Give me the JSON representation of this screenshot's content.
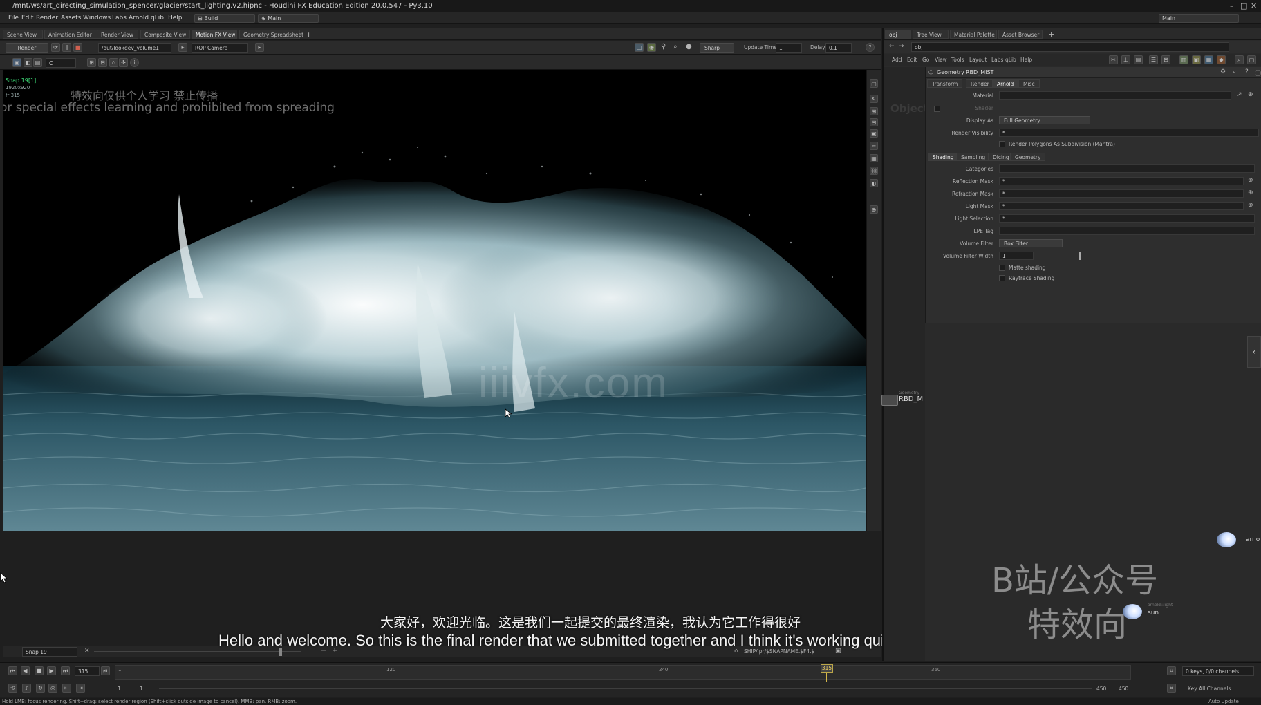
{
  "window": {
    "title": "/mnt/ws/art_directing_simulation_spencer/glacier/start_lighting.v2.hipnc - Houdini FX Education Edition 20.0.547 - Py3.10"
  },
  "menubar": {
    "items": [
      "File",
      "Edit",
      "Render",
      "Assets",
      "Windows",
      "Labs",
      "Arnold",
      "qLib",
      "Help"
    ],
    "desktop": "Build",
    "desktop2": "Main",
    "right_desktop": "Main"
  },
  "left_tabs": [
    "Scene View",
    "Animation Editor",
    "Render View",
    "Composite View",
    "Motion FX View",
    "Geometry Spreadsheet"
  ],
  "toolbar": {
    "render_btn": "Render",
    "rop_path": "/out/lookdev_volume1",
    "camera": "ROP Camera",
    "shading": "Sharp",
    "update_time_label": "Update Time",
    "update_time": "1",
    "delay_label": "Delay",
    "delay": "0.1"
  },
  "viewport": {
    "snap_label": "Snap 19[1]",
    "snap_res": "1920x920",
    "snap_frame": "fr 315",
    "watermark_cn": "特效向仅供个人学习 禁止传播",
    "watermark_en": "or special effects learning and prohibited from spreading",
    "watermark_site": "iiivfx.com"
  },
  "render_ctrl": {
    "snap": "Snap 19",
    "output": "SHIP/ipr/$SNAPNAME.$F4.$"
  },
  "subtitles": {
    "cn": "大家好，欢迎光临。这是我们一起提交的最终渲染，我认为它工作得很好",
    "en": "Hello and welcome. So this is the final render that we submitted together and I think it's working quite well"
  },
  "timeline": {
    "frame": "315",
    "start": "1",
    "start2": "1",
    "ticks": [
      "1",
      "120",
      "240",
      "360"
    ],
    "end": "450",
    "end2": "450",
    "keys": "0 keys, 0/0 channels",
    "key_all": "Key All Channels",
    "auto_update": "Auto Update"
  },
  "status": {
    "text": "Hold LMB: focus rendering. Shift+drag: select render region (Shift+click outside image to cancel). MMB: pan. RMB: zoom."
  },
  "right_pane": {
    "tabs": [
      "obj",
      "Tree View",
      "Material Palette",
      "Asset Browser"
    ],
    "path": "obj",
    "menu": [
      "Add",
      "Edit",
      "Go",
      "View",
      "Tools",
      "Layout",
      "Labs",
      "qLib",
      "Help"
    ],
    "node_type": "Geometry",
    "node_name": "RBD_MIST",
    "param_tabs": [
      "Transform",
      "Render",
      "Arnold",
      "Misc"
    ],
    "params": {
      "material": "Material",
      "shader": "Shader",
      "display_as": "Display As",
      "display_as_value": "Full Geometry",
      "render_visibility": "Render Visibility",
      "render_visibility_value": "*",
      "render_polys": "Render Polygons As Subdivision (Mantra)",
      "sub_tabs": [
        "Shading",
        "Sampling",
        "Dicing",
        "Geometry"
      ],
      "categories": "Categories",
      "reflection_mask": "Reflection Mask",
      "reflection_value": "*",
      "refraction_mask": "Refraction Mask",
      "refraction_value": "*",
      "light_mask": "Light Mask",
      "light_value": "*",
      "light_selection": "Light Selection",
      "light_selection_value": "*",
      "lpe_tag": "LPE Tag",
      "volume_filter": "Volume Filter",
      "volume_filter_value": "Box Filter",
      "volume_filter_width": "Volume Filter Width",
      "volume_filter_width_value": "1",
      "matte_shading": "Matte shading",
      "raytrace_shading": "Raytrace Shading"
    },
    "network": {
      "objects_label": "Objects",
      "node_label": "RBD_M",
      "node_sublabel": "Geometry",
      "light1": "arno",
      "light2_type": "arnold::light",
      "light2": "sun"
    },
    "watermark_line1": "B站/公众号",
    "watermark_line2": "特效向"
  }
}
